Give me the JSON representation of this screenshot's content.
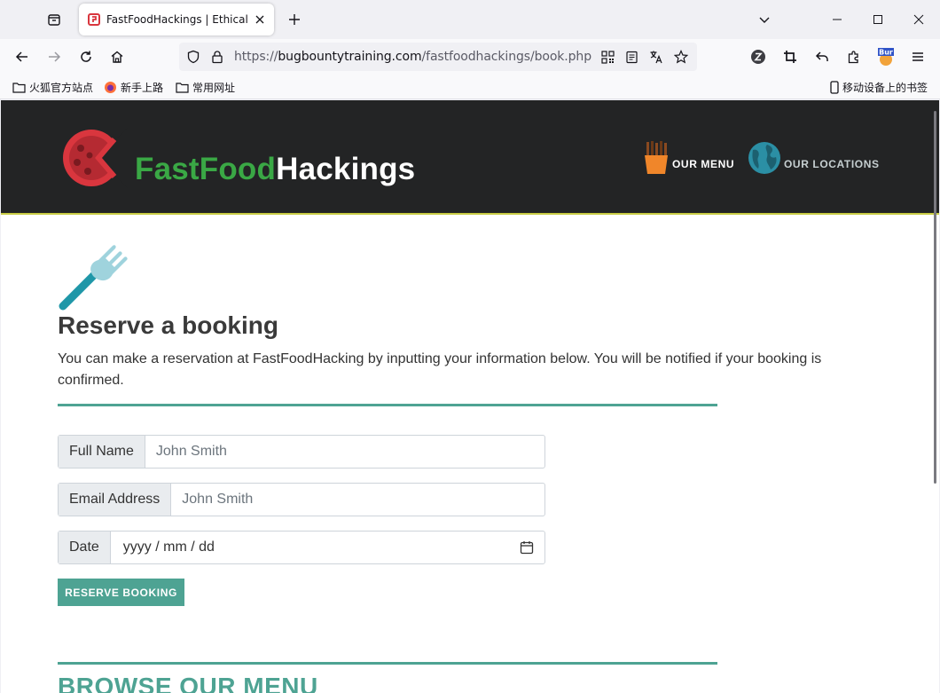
{
  "browser": {
    "tab_title": "FastFoodHackings | Ethical H",
    "url_prefix": "https://",
    "url_host": "bugbountytraining.com",
    "url_path": "/fastfoodhackings/book.php",
    "bookmarks": [
      {
        "label": "火狐官方站点"
      },
      {
        "label": "新手上路"
      },
      {
        "label": "常用网址"
      }
    ],
    "mobile_bookmarks": "移动设备上的书签"
  },
  "site": {
    "brand_part1": "FastFood",
    "brand_part2": "Hackings",
    "nav": {
      "menu": "OUR MENU",
      "locations": "OUR LOCATIONS"
    }
  },
  "booking": {
    "title": "Reserve a booking",
    "intro": "You can make a reservation at FastFoodHacking by inputting your information below. You will be notified if your booking is confirmed.",
    "fields": {
      "name_label": "Full Name",
      "name_placeholder": "John Smith",
      "email_label": "Email Address",
      "email_placeholder": "John Smith",
      "date_label": "Date",
      "date_placeholder": "yyyy / mm / dd"
    },
    "submit": "RESERVE BOOKING"
  },
  "browse": {
    "title": "BROWSE OUR MENU"
  },
  "colors": {
    "accent": "#4ea393",
    "brand_green": "#3aa845",
    "header_bg": "#232425",
    "logo_red": "#d9363e"
  }
}
